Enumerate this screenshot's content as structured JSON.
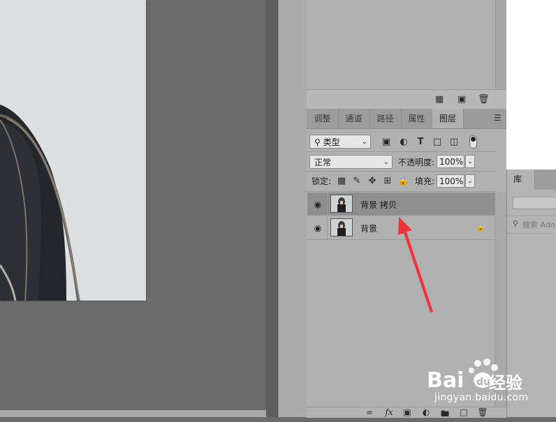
{
  "layers_panel": {
    "tabs": [
      "调整",
      "通道",
      "路径",
      "属性",
      "图层"
    ],
    "active_tab": "图层",
    "filter": {
      "kind_label": "类型",
      "icons": [
        "image-filter-icon",
        "adjustment-filter-icon",
        "type-filter-icon",
        "shape-filter-icon",
        "smart-object-filter-icon"
      ]
    },
    "blend_mode": "正常",
    "opacity_label": "不透明度:",
    "opacity_value": "100%",
    "lock_label": "锁定:",
    "fill_label": "填充:",
    "fill_value": "100%",
    "layers": [
      {
        "name": "背景 拷贝",
        "visible": true,
        "selected": true,
        "locked": false
      },
      {
        "name": "背景",
        "visible": true,
        "selected": false,
        "locked": true
      }
    ]
  },
  "library_panel": {
    "tab_label": "库",
    "search_placeholder": "搜索 Ado"
  },
  "watermark": {
    "brand": "Bai",
    "brand_suffix": "经验",
    "url": "jingyan.baidu.com"
  },
  "colors": {
    "canvas_bg": "#6b6b6b",
    "panel_bg": "#b1b1b1",
    "selected_row": "#8f8f8f",
    "arrow": "#f0353a"
  }
}
